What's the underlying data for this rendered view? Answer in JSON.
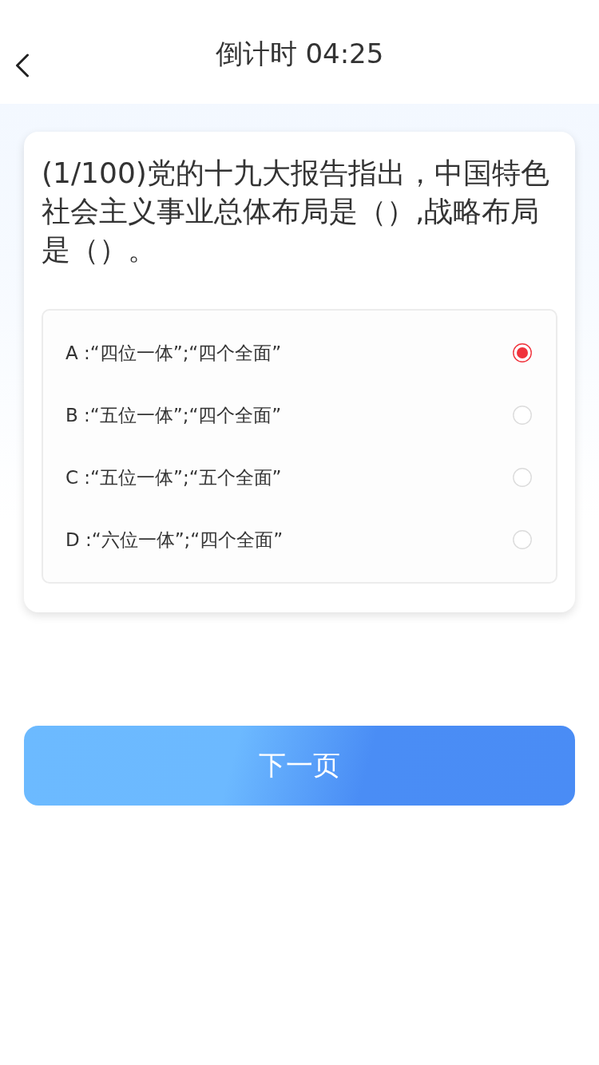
{
  "header": {
    "title": "倒计时 04:25"
  },
  "question": {
    "text": "(1/100)党的十九大报告指出，中国特色社会主义事业总体布局是（）,战略布局是（）。",
    "options": [
      {
        "label": "A :“四位一体”;“四个全面”",
        "selected": true
      },
      {
        "label": "B :“五位一体”;“四个全面”",
        "selected": false
      },
      {
        "label": "C :“五位一体”;“五个全面”",
        "selected": false
      },
      {
        "label": "D :“六位一体”;“四个全面”",
        "selected": false
      }
    ]
  },
  "next_button": {
    "label": "下一页"
  }
}
